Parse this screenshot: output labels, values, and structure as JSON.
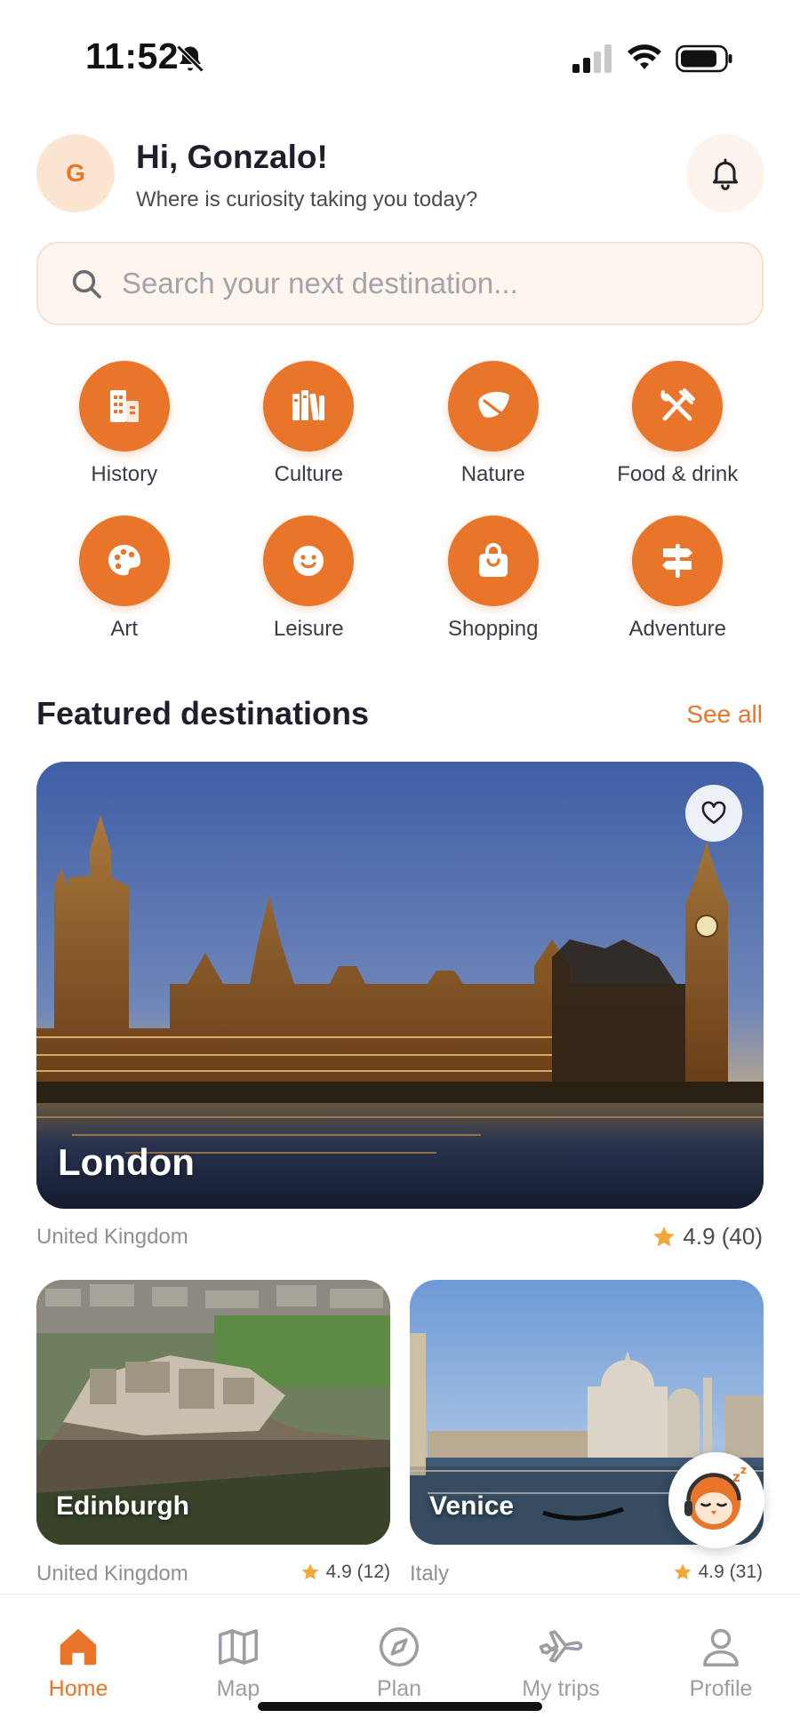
{
  "status_bar": {
    "time": "11:52"
  },
  "header": {
    "avatar_initial": "G",
    "greeting": "Hi, Gonzalo!",
    "subtitle": "Where is curiosity taking you today?"
  },
  "search": {
    "placeholder": "Search your next destination..."
  },
  "categories": [
    {
      "label": "History",
      "icon": "buildings-icon"
    },
    {
      "label": "Culture",
      "icon": "books-icon"
    },
    {
      "label": "Nature",
      "icon": "leaf-icon"
    },
    {
      "label": "Food & drink",
      "icon": "fork-knife-icon"
    },
    {
      "label": "Art",
      "icon": "palette-icon"
    },
    {
      "label": "Leisure",
      "icon": "smile-icon"
    },
    {
      "label": "Shopping",
      "icon": "shopping-bag-icon"
    },
    {
      "label": "Adventure",
      "icon": "signpost-icon"
    }
  ],
  "featured": {
    "title": "Featured destinations",
    "see_all": "See all",
    "destinations": [
      {
        "name": "London",
        "country": "United Kingdom",
        "rating": "4.9 (40)"
      },
      {
        "name": "Edinburgh",
        "country": "United Kingdom",
        "rating": "4.9 (12)"
      },
      {
        "name": "Venice",
        "country": "Italy",
        "rating": "4.9 (31)"
      }
    ]
  },
  "bottom_nav": [
    {
      "label": "Home",
      "active": true
    },
    {
      "label": "Map",
      "active": false
    },
    {
      "label": "Plan",
      "active": false
    },
    {
      "label": "My trips",
      "active": false
    },
    {
      "label": "Profile",
      "active": false
    }
  ],
  "colors": {
    "accent": "#e8752a",
    "rating_star": "#f2a93b",
    "text_dark": "#1f1f2b"
  }
}
